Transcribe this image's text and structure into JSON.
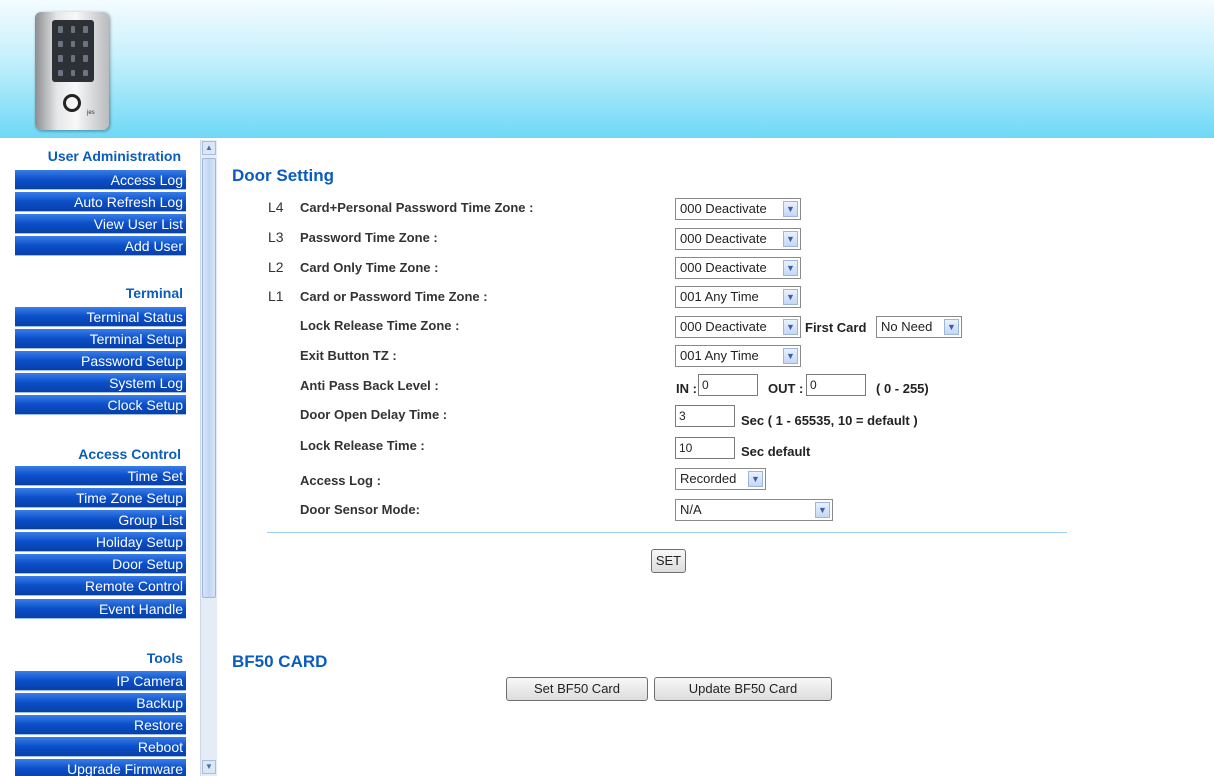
{
  "sidebar": {
    "sections": [
      {
        "title": "User Administration",
        "items": [
          "Access Log",
          "Auto Refresh Log",
          "View User List",
          "Add User"
        ]
      },
      {
        "title": "Terminal",
        "items": [
          "Terminal Status",
          "Terminal Setup",
          "Password Setup",
          "System Log",
          "Clock Setup"
        ]
      },
      {
        "title": "Access Control",
        "items": [
          "Time Set",
          "Time Zone Setup",
          "Group List",
          "Holiday Setup",
          "Door Setup",
          "Remote Control",
          "Event Handle"
        ]
      },
      {
        "title": "Tools",
        "items": [
          "IP Camera",
          "Backup",
          "Restore",
          "Reboot",
          "Upgrade Firmware"
        ]
      }
    ]
  },
  "door_setting": {
    "title": "Door Setting",
    "rows": [
      {
        "level": "L4",
        "label": "Card+Personal Password Time Zone :",
        "value": "000 Deactivate"
      },
      {
        "level": "L3",
        "label": "Password Time Zone :",
        "value": "000 Deactivate"
      },
      {
        "level": "L2",
        "label": "Card Only Time Zone :",
        "value": "000 Deactivate"
      },
      {
        "level": "L1",
        "label": "Card or Password Time Zone :",
        "value": "001 Any Time"
      },
      {
        "level": "",
        "label": "Lock Release Time Zone :",
        "value": "000 Deactivate"
      },
      {
        "level": "",
        "label": "Exit Button TZ :",
        "value": "001 Any Time"
      }
    ],
    "first_card_label": "First Card",
    "first_card_value": "No Need",
    "anti_pass_back": {
      "label": "Anti Pass Back Level :",
      "in_label": "IN :",
      "in_value": "0",
      "out_label": "OUT :",
      "out_value": "0",
      "range": "( 0 - 255)"
    },
    "door_open_delay": {
      "label": "Door Open Delay Time  :",
      "value": "3",
      "hint": "Sec ( 1 - 65535, 10 = default )"
    },
    "lock_release_time": {
      "label": "Lock Release Time  :",
      "value": "10",
      "hint": "Sec default"
    },
    "access_log": {
      "label": "Access Log :",
      "value": "Recorded"
    },
    "door_sensor_mode": {
      "label": "Door Sensor Mode:",
      "value": "N/A"
    },
    "set_button": "SET"
  },
  "bf50": {
    "title": "BF50 CARD",
    "set_button": "Set BF50 Card",
    "update_button": "Update BF50 Card"
  },
  "device": {
    "brand": "jes"
  },
  "colors": {
    "accent": "#0a5cbf",
    "nav_bg": "#0b4fc9",
    "header_bottom": "#6fd8f6"
  }
}
